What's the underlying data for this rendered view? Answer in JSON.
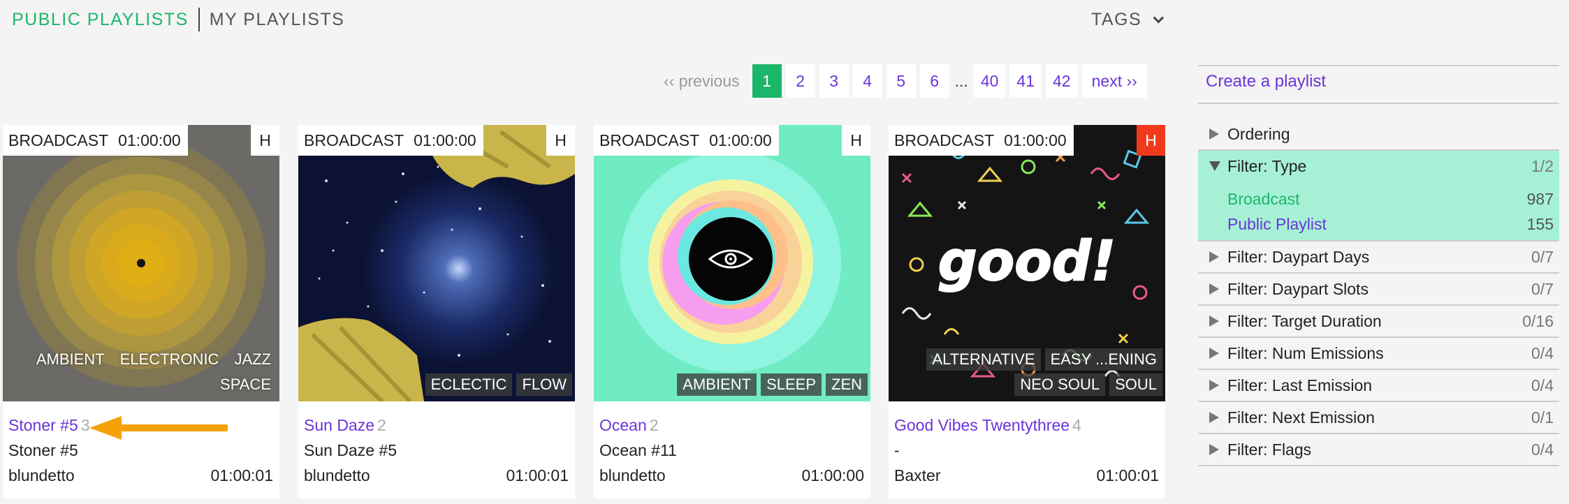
{
  "nav": {
    "public_tab": "PUBLIC PLAYLISTS",
    "mine_tab": "MY PLAYLISTS",
    "tags_label": "TAGS"
  },
  "pagination": {
    "prev": "‹‹ previous",
    "pages": [
      "1",
      "2",
      "3",
      "4",
      "5",
      "6"
    ],
    "ellipsis": "...",
    "tail_pages": [
      "40",
      "41",
      "42"
    ],
    "next": "next ››",
    "current": "1"
  },
  "cards": [
    {
      "type": "BROADCAST",
      "duration": "01:00:00",
      "h": "H",
      "h_hot": false,
      "tags_top": [
        "AMBIENT",
        "ELECTRONIC",
        "JAZZ"
      ],
      "tags_bottom": [
        "SPACE"
      ],
      "title": "Stoner #5",
      "count": "3",
      "subtitle": "Stoner #5",
      "owner": "blundetto",
      "length": "01:00:01"
    },
    {
      "type": "BROADCAST",
      "duration": "01:00:00",
      "h": "H",
      "h_hot": false,
      "tags_top": [],
      "tags_bottom": [
        "ECLECTIC",
        "FLOW"
      ],
      "title": "Sun Daze",
      "count": "2",
      "subtitle": "Sun Daze #5",
      "owner": "blundetto",
      "length": "01:00:01"
    },
    {
      "type": "BROADCAST",
      "duration": "01:00:00",
      "h": "H",
      "h_hot": false,
      "tags_top": [],
      "tags_bottom": [
        "AMBIENT",
        "SLEEP",
        "ZEN"
      ],
      "title": "Ocean",
      "count": "2",
      "subtitle": "Ocean #11",
      "owner": "blundetto",
      "length": "01:00:00"
    },
    {
      "type": "BROADCAST",
      "duration": "01:00:00",
      "h": "H",
      "h_hot": true,
      "tags_top": [
        "ALTERNATIVE",
        "EASY ...ENING"
      ],
      "tags_bottom": [
        "NEO SOUL",
        "SOUL"
      ],
      "title": "Good Vibes Twentythree",
      "count": "4",
      "subtitle": "-",
      "owner": "Baxter",
      "length": "01:00:01",
      "art_text": "good!"
    }
  ],
  "sidebar": {
    "create": "Create a playlist",
    "filters": [
      {
        "label": "Ordering",
        "count": ""
      },
      {
        "label": "Filter: Type",
        "count": "1/2",
        "open": true,
        "options": [
          {
            "label": "Broadcast",
            "count": "987"
          },
          {
            "label": "Public Playlist",
            "count": "155"
          }
        ]
      },
      {
        "label": "Filter: Daypart Days",
        "count": "0/7"
      },
      {
        "label": "Filter: Daypart Slots",
        "count": "0/7"
      },
      {
        "label": "Filter: Target Duration",
        "count": "0/16"
      },
      {
        "label": "Filter: Num Emissions",
        "count": "0/4"
      },
      {
        "label": "Filter: Last Emission",
        "count": "0/4"
      },
      {
        "label": "Filter: Next Emission",
        "count": "0/1"
      },
      {
        "label": "Filter: Flags",
        "count": "0/4"
      }
    ]
  },
  "colors": {
    "accent_green": "#1cb66a",
    "link_purple": "#6a35d8",
    "hot_red": "#f03a1a",
    "filter_open_bg": "#a6f1d6",
    "arrow_orange": "#f5a20a"
  }
}
